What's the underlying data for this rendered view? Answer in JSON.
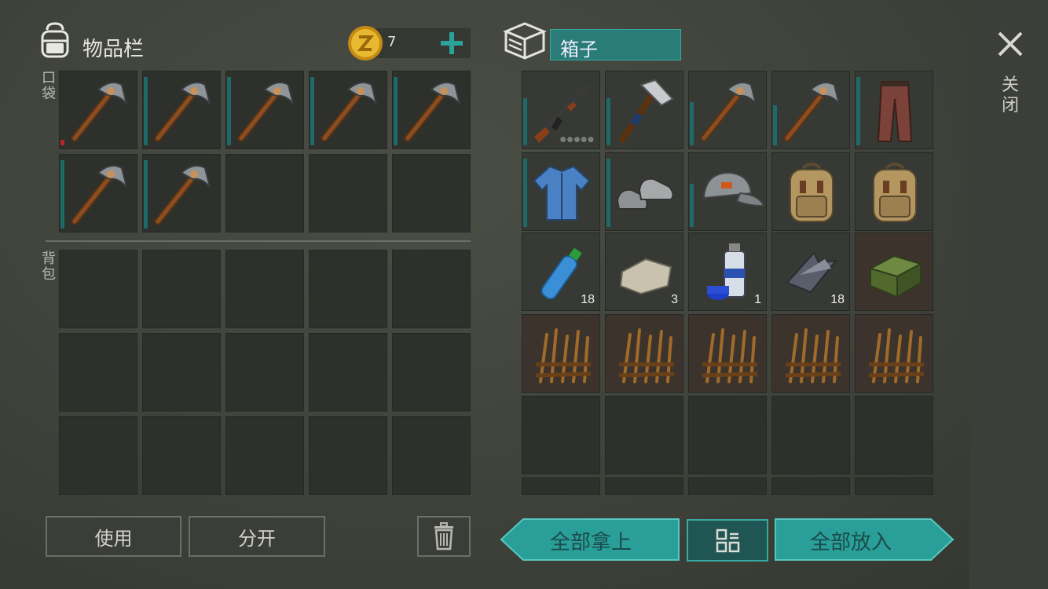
{
  "inventory": {
    "title": "物品栏",
    "coins": "7",
    "pocket_label": "口袋",
    "backpack_label": "背包",
    "pocket_slots": [
      {
        "item": "pickaxe-icon",
        "durability": 0.08,
        "low": true
      },
      {
        "item": "pickaxe-icon",
        "durability": 0.95
      },
      {
        "item": "pickaxe-icon",
        "durability": 0.95
      },
      {
        "item": "pickaxe-icon",
        "durability": 0.95
      },
      {
        "item": "pickaxe-icon",
        "durability": 0.95
      },
      {
        "item": "pickaxe-icon",
        "durability": 0.95
      },
      {
        "item": "pickaxe-icon",
        "durability": 0.95
      },
      {
        "item": "",
        "durability": 0
      },
      {
        "item": "",
        "durability": 0
      },
      {
        "item": "",
        "durability": 0
      }
    ],
    "buttons": {
      "use": "使用",
      "split": "分开"
    }
  },
  "chest": {
    "title": "箱子",
    "slots": [
      {
        "item": "ak47-icon",
        "durability": 0.65,
        "dots": "●●●●●"
      },
      {
        "item": "hammer-icon",
        "durability": 0.65
      },
      {
        "item": "pickaxe-icon",
        "durability": 0.6
      },
      {
        "item": "pickaxe-icon",
        "durability": 0.55
      },
      {
        "item": "pants-icon",
        "durability": 0.95
      },
      {
        "item": "shirt-icon",
        "durability": 0.95
      },
      {
        "item": "sneakers-icon",
        "durability": 0.95
      },
      {
        "item": "cap-icon",
        "durability": 0.6
      },
      {
        "item": "backpack-icon",
        "durability": 0
      },
      {
        "item": "backpack-icon",
        "durability": 0
      },
      {
        "item": "water-bottle-icon",
        "count": "18"
      },
      {
        "item": "stone-icon",
        "count": "3"
      },
      {
        "item": "spray-paint-icon",
        "count": "1"
      },
      {
        "item": "scrap-metal-icon",
        "count": "18"
      },
      {
        "item": "ammo-crate-icon"
      },
      {
        "item": "spike-trap-icon"
      },
      {
        "item": "spike-trap-icon"
      },
      {
        "item": "spike-trap-icon"
      },
      {
        "item": "spike-trap-icon"
      },
      {
        "item": "spike-trap-icon"
      }
    ],
    "buttons": {
      "take_all": "全部拿上",
      "put_all": "全部放入"
    }
  },
  "close_label": "关闭",
  "colors": {
    "teal": "#2a9e98",
    "teal_dark": "#1e6f6b",
    "durability": "#1d6a68",
    "low_durability": "#b42626"
  }
}
